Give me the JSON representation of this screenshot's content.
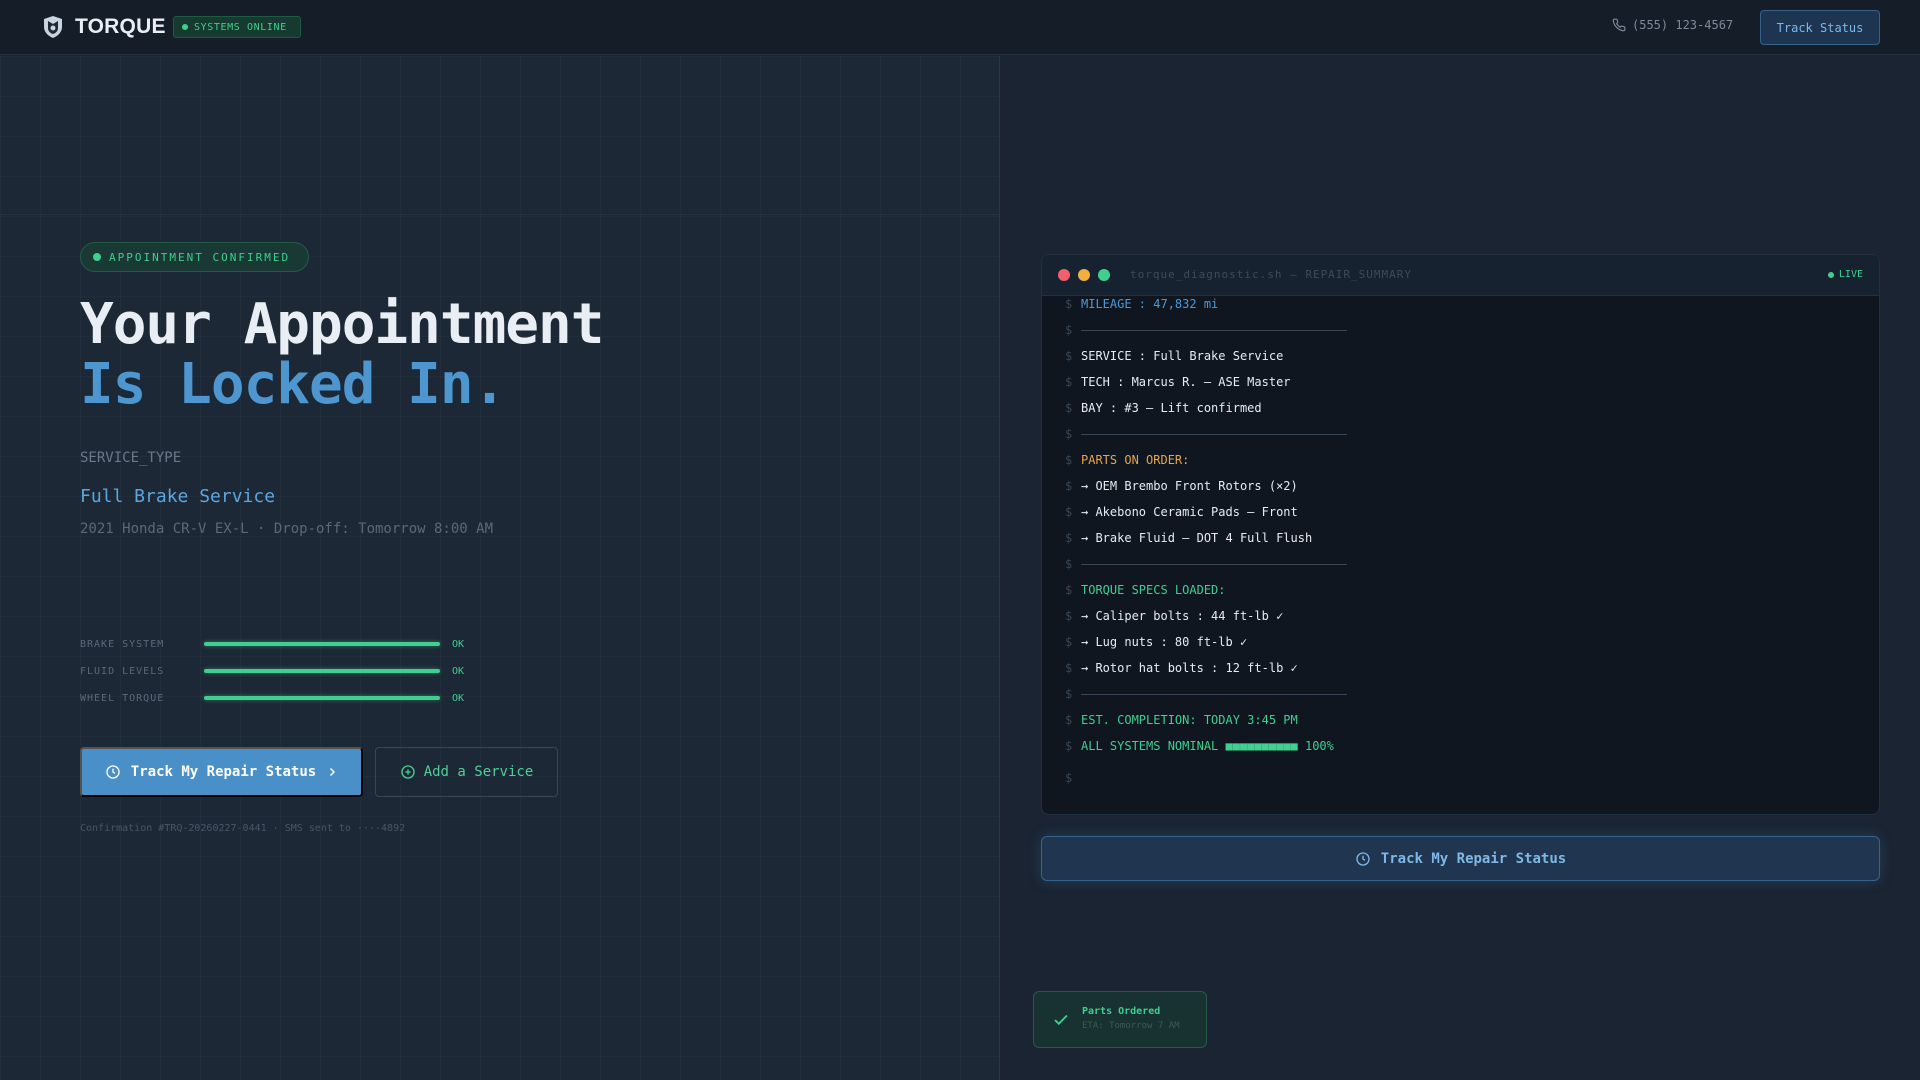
{
  "header": {
    "brand": "TORQUE",
    "status_badge": "SYSTEMS ONLINE",
    "phone": "(555) 123-4567",
    "track_button": "Track Status"
  },
  "hero": {
    "badge": "APPOINTMENT CONFIRMED",
    "headline_1": "Your Appointment",
    "headline_2": "Is Locked In.",
    "service_type_label": "SERVICE_TYPE",
    "service_name": "Full Brake Service",
    "service_meta": "2021 Honda CR-V EX-L · Drop-off: Tomorrow 8:00 AM",
    "status_checks": [
      {
        "label": "BRAKE SYSTEM",
        "status": "OK",
        "progress": 1.0
      },
      {
        "label": "FLUID LEVELS",
        "status": "OK",
        "progress": 1.0
      },
      {
        "label": "WHEEL TORQUE",
        "status": "OK",
        "progress": 1.0
      }
    ],
    "primary_button": "Track My Repair Status",
    "secondary_button": "Add a Service",
    "confirmation": "Confirmation #TRQ-20260227-0441 · SMS sent to ···-4892"
  },
  "terminal": {
    "title": "torque_diagnostic.sh — REPAIR_SUMMARY",
    "live_label": "LIVE",
    "prompt": "$",
    "lines": {
      "mileage": "MILEAGE : 47,832 mi",
      "service": "SERVICE : Full Brake Service",
      "tech": "TECH : Marcus R. — ASE Master",
      "bay": "BAY : #3 — Lift confirmed",
      "parts_header": "PARTS ON ORDER:",
      "part_1": "→ OEM Brembo Front Rotors (×2)",
      "part_2": "→ Akebono Ceramic Pads — Front",
      "part_3": "→ Brake Fluid — DOT 4 Full Flush",
      "specs_header": "TORQUE SPECS LOADED:",
      "spec_1": "→ Caliper bolts : 44 ft-lb ✓",
      "spec_2": "→ Lug nuts : 80 ft-lb ✓",
      "spec_3": "→ Rotor hat bolts : 12 ft-lb ✓",
      "completion": "EST. COMPLETION: TODAY 3:45 PM",
      "nominal": "ALL SYSTEMS NOMINAL ■■■■■■■■■■ 100%"
    }
  },
  "track_panel_button": "Track My Repair Status",
  "toast": {
    "title": "Parts Ordered",
    "subtitle": "ETA: Tomorrow 7 AM"
  },
  "colors": {
    "accent_blue": "#4a90c8",
    "status_green": "#3fcf8e",
    "warning_orange": "#e8a448",
    "background": "#1a2432"
  },
  "icons": [
    "shield-logo-icon",
    "phone-icon",
    "clock-icon",
    "chevron-right-icon",
    "plus-circle-icon",
    "check-icon"
  ]
}
